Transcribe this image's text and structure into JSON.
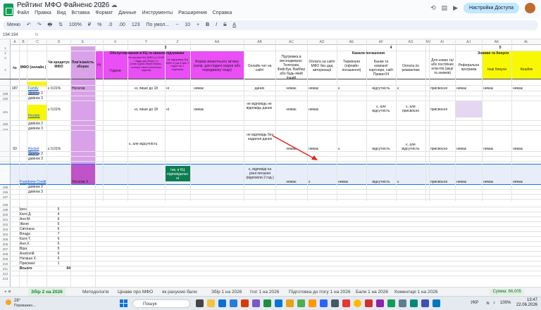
{
  "app": {
    "title": "Рейтинг МФО Файненс 2026",
    "menu": [
      "Файл",
      "Правка",
      "Вид",
      "Вставка",
      "Формат",
      "Данные",
      "Инструменты",
      "Расширения",
      "Справка"
    ],
    "share": "Настройки Доступа"
  },
  "toolbar": {
    "items": [
      "Меню",
      "↶",
      "↷",
      "🖶",
      "⇅",
      "100%",
      "₽",
      "%",
      ".0",
      ".00",
      "123",
      "По умол...",
      "−",
      "10",
      "+",
      "B",
      "I",
      "S",
      "A"
    ]
  },
  "formula": {
    "cell": "194:194",
    "fx": "fx"
  },
  "cols": [
    "A",
    "B",
    "C",
    "D",
    "E",
    "X",
    "Y",
    "Z",
    "AA",
    "AB",
    "AC",
    "AD",
    "AE",
    "AF",
    "AG",
    "AH",
    "AI",
    "AJ",
    "AK",
    "AL"
  ],
  "rows": {
    "n1": "1",
    "n2": "2",
    "n3": "3",
    "n4": "4",
    "r189": "189",
    "r190": "190",
    "r191": "191",
    "r192": "192",
    "r193": "193",
    "r194": "194",
    "r195": "195",
    "r196": "196",
    "r197": "197",
    "r198": "198",
    "r199": "199",
    "r200": "200",
    "r201": "201",
    "r202": "202",
    "r203": "203",
    "r204": "204",
    "r205": "205",
    "r206": "206",
    "r207": "207",
    "r208": "208",
    "r209": "209",
    "r210": "210",
    "r211": "211",
    "r212": "212",
    "r213": "213"
  },
  "header": {
    "s3": "3",
    "s4": "4",
    "s5": "5",
    "g_service": "Обслуговування в КЦ та канали підтримки",
    "g_channels": "Канали погашення",
    "g_bonus": "Знижки та бонуси",
    "num": "№",
    "mfo": "МФО (онлайн )",
    "credit": "Чи кредитує МФО",
    "dup": "Пов'язаність зборах",
    "z1": "Ні ",
    "callcenter": "Години",
    "cc_q": "На протязі КЦ МФО (з 19:00 і будь-дні (5хв)? (з 10хв,чорно-білий бізнес, чотири тижні клієнтські години)",
    "cc_q2": "на підтримці КЦ МФО є (за 5 або 7 годин на 1 ліцензію)",
    "feedback": "Форма зворотнього зв'язку (напр. для подачі скарги або передзвону тощо)",
    "onlinechat": "Онлайн чат на сайті",
    "messengers": "Підтримка в месенджерах: Телеграм, Фейсбук, Вайбер або будь-який інший",
    "pay_site": "Оплата на сайті МФО без дад авторизації",
    "terminals": "Термінали (офлайн погашення)",
    "banks": "Банки та компанії партнери, сайт Приват24",
    "pay_req": "Оплата по реквізитам",
    "new_clients": "Для нових та/або постійних клієнтів (акції та знижки)",
    "referral": "Реферальна програма",
    "other_bonus": "Інші бонуси",
    "cashback": "Кешбек"
  },
  "cells": {
    "n188": "187",
    "mfo1": "Family Money",
    "credit1": "є 0,01%",
    "dup1": "Негатив",
    "y1": "≡",
    "cc1": "ні, лише до 18",
    "cc2_1": "ні",
    "fb1": "немає",
    "chat1": "даних",
    "msg1": "немає",
    "site1": "немає",
    "term1": "є",
    "bank1": "відсутність",
    "req1": "є",
    "new1": "присвоєно",
    "ref1": "немає",
    "oth1": "немає",
    "cb1": "немає",
    "l189": "дзвінок 2",
    "l190": "дзвінок 3",
    "mfo2": "Finclick",
    "credit2": "є 0,01%",
    "cc3": "ні, лише до 18",
    "cc2_2": "ні",
    "fb2": "немає",
    "chat2": "не відповідь не відповідь даних",
    "msg2": "немає",
    "site2": "немає",
    "bank2": "є, але відсутність",
    "req2": "є, але присвоєно",
    "new2": "присвоєно",
    "l192": "дзвінок 2",
    "l193": "дзвінок 3",
    "n193": "93",
    "mfo3": "Rocket Money",
    "credit3": "є 0,01%",
    "cc4": "є, але відсутність",
    "chat3": "не відповідь без надання даних",
    "msg3": "немає",
    "site3": "немає",
    "term3": "є",
    "bank3": "відсутність",
    "req3": "є, але відсутність",
    "new3": "присвоєно",
    "ref3": "немає",
    "oth3": "немає",
    "cb3": "немає",
    "l196": "дзвінок 2",
    "l197": "дзвінок 3",
    "n194": "194",
    "mfo4": "Freedome Credit",
    "dup4": "Негатив Х",
    "cc5": "так, в КЦ підповідальн ні",
    "chat4": "є, відповіді на різні питання (відповіли 2 год.)",
    "msg4": "немає",
    "site4": "є",
    "term4": "немає",
    "bank4": "відсутність",
    "req4": "є",
    "new4": "присвоєно",
    "ref4": "немає",
    "oth4": "немає",
    "cb4": "немає",
    "l199": "дзвінок 2",
    "l200": "дзвінок 3"
  },
  "people": [
    [
      "Ірен",
      "6"
    ],
    [
      "Катя Д.",
      "4"
    ],
    [
      "Аня М.",
      "6"
    ],
    [
      "Женя",
      "6"
    ],
    [
      "Світлана",
      "6"
    ],
    [
      "Влада",
      "7"
    ],
    [
      "Катя Т.",
      "6"
    ],
    [
      "Аня Х.",
      "5"
    ],
    [
      "Віра",
      "5"
    ],
    [
      "Анатолій",
      "6"
    ],
    [
      "Наташа Х.",
      "6"
    ],
    [
      "Присяжні",
      "1"
    ]
  ],
  "total": {
    "label": "Всього",
    "value": "64"
  },
  "tabs": {
    "items": [
      "Збір 2 на 2026",
      "Методологія",
      "Цінаве про МФО",
      "як рахуємо бали",
      "Збір 1 на 2026",
      "Ітог 1 на 2026",
      "Підготовка до ітогу 1 на 2026",
      "Бали 1 на 2026",
      "Коментарі 1 на 2026"
    ],
    "sum": "Сумма: 66,005"
  },
  "taskbar": {
    "temp": "28°",
    "weather": "Переважно...",
    "search": "Пошук",
    "lang": "УКР",
    "time": "13:47",
    "date": "22.06.2026",
    "battery": "100%"
  }
}
